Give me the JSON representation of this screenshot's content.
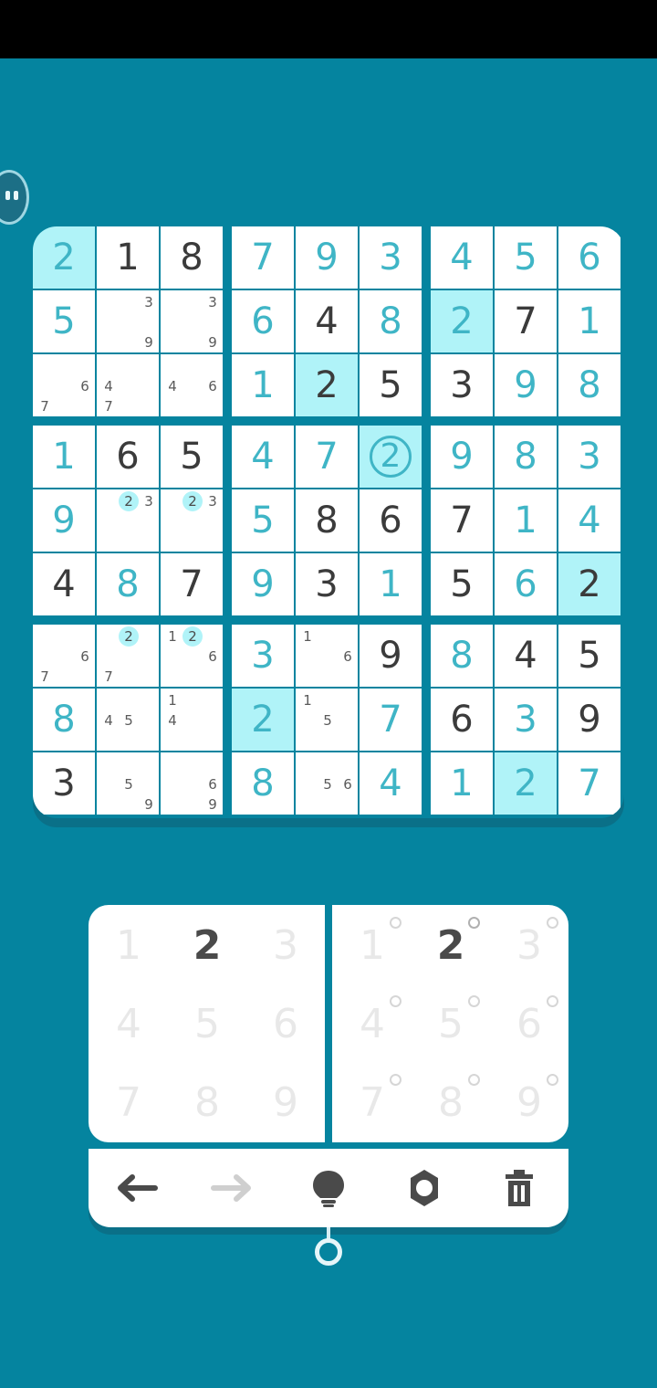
{
  "board": {
    "rows": [
      [
        {
          "v": "2",
          "t": "user",
          "hl": true
        },
        {
          "v": "1",
          "t": "given"
        },
        {
          "v": "8",
          "t": "given"
        },
        {
          "v": "7",
          "t": "user"
        },
        {
          "v": "9",
          "t": "user"
        },
        {
          "v": "3",
          "t": "user"
        },
        {
          "v": "4",
          "t": "user"
        },
        {
          "v": "5",
          "t": "user"
        },
        {
          "v": "6",
          "t": "user"
        }
      ],
      [
        {
          "v": "5",
          "t": "user"
        },
        {
          "notes": [
            "3",
            "9"
          ]
        },
        {
          "notes": [
            "3",
            "9"
          ]
        },
        {
          "v": "6",
          "t": "user"
        },
        {
          "v": "4",
          "t": "given"
        },
        {
          "v": "8",
          "t": "user"
        },
        {
          "v": "2",
          "t": "user",
          "hl": true
        },
        {
          "v": "7",
          "t": "given"
        },
        {
          "v": "1",
          "t": "user"
        }
      ],
      [
        {
          "notes": [
            "6",
            "7"
          ]
        },
        {
          "notes": [
            "4",
            "7"
          ]
        },
        {
          "notes": [
            "4",
            "6"
          ]
        },
        {
          "v": "1",
          "t": "user"
        },
        {
          "v": "2",
          "t": "given",
          "hl": true
        },
        {
          "v": "5",
          "t": "given"
        },
        {
          "v": "3",
          "t": "given"
        },
        {
          "v": "9",
          "t": "user"
        },
        {
          "v": "8",
          "t": "user"
        }
      ],
      [
        {
          "v": "1",
          "t": "user"
        },
        {
          "v": "6",
          "t": "given"
        },
        {
          "v": "5",
          "t": "given"
        },
        {
          "v": "4",
          "t": "user"
        },
        {
          "v": "7",
          "t": "user"
        },
        {
          "v": "2",
          "t": "user",
          "hl": true,
          "ring": true
        },
        {
          "v": "9",
          "t": "user"
        },
        {
          "v": "8",
          "t": "user"
        },
        {
          "v": "3",
          "t": "user"
        }
      ],
      [
        {
          "v": "9",
          "t": "user"
        },
        {
          "notes": [
            "2",
            "3"
          ],
          "noteHl": [
            "2"
          ]
        },
        {
          "notes": [
            "2",
            "3"
          ],
          "noteHl": [
            "2"
          ]
        },
        {
          "v": "5",
          "t": "user"
        },
        {
          "v": "8",
          "t": "given"
        },
        {
          "v": "6",
          "t": "given"
        },
        {
          "v": "7",
          "t": "given"
        },
        {
          "v": "1",
          "t": "user"
        },
        {
          "v": "4",
          "t": "user"
        }
      ],
      [
        {
          "v": "4",
          "t": "given"
        },
        {
          "v": "8",
          "t": "user"
        },
        {
          "v": "7",
          "t": "given"
        },
        {
          "v": "9",
          "t": "user"
        },
        {
          "v": "3",
          "t": "given"
        },
        {
          "v": "1",
          "t": "user"
        },
        {
          "v": "5",
          "t": "given"
        },
        {
          "v": "6",
          "t": "user"
        },
        {
          "v": "2",
          "t": "given",
          "hl": true
        }
      ],
      [
        {
          "notes": [
            "6",
            "7"
          ]
        },
        {
          "notes": [
            "2",
            "7"
          ],
          "noteHl": [
            "2"
          ]
        },
        {
          "notes": [
            "1",
            "2",
            "6"
          ],
          "noteHl": [
            "2"
          ]
        },
        {
          "v": "3",
          "t": "user"
        },
        {
          "notes": [
            "1",
            "6"
          ]
        },
        {
          "v": "9",
          "t": "given"
        },
        {
          "v": "8",
          "t": "user"
        },
        {
          "v": "4",
          "t": "given"
        },
        {
          "v": "5",
          "t": "given"
        }
      ],
      [
        {
          "v": "8",
          "t": "user"
        },
        {
          "notes": [
            "4",
            "5"
          ]
        },
        {
          "notes": [
            "1",
            "4"
          ]
        },
        {
          "v": "2",
          "t": "user",
          "hl": true
        },
        {
          "notes": [
            "1",
            "5"
          ]
        },
        {
          "v": "7",
          "t": "user"
        },
        {
          "v": "6",
          "t": "given"
        },
        {
          "v": "3",
          "t": "user"
        },
        {
          "v": "9",
          "t": "given"
        }
      ],
      [
        {
          "v": "3",
          "t": "given"
        },
        {
          "notes": [
            "5",
            "9"
          ]
        },
        {
          "notes": [
            "6",
            "9"
          ]
        },
        {
          "v": "8",
          "t": "user"
        },
        {
          "notes": [
            "5",
            "6"
          ]
        },
        {
          "v": "4",
          "t": "user"
        },
        {
          "v": "1",
          "t": "user"
        },
        {
          "v": "2",
          "t": "user",
          "hl": true
        },
        {
          "v": "7",
          "t": "user"
        }
      ]
    ]
  },
  "numpad": {
    "value_keys": [
      "1",
      "2",
      "3",
      "4",
      "5",
      "6",
      "7",
      "8",
      "9"
    ],
    "note_keys": [
      "1",
      "2",
      "3",
      "4",
      "5",
      "6",
      "7",
      "8",
      "9"
    ],
    "active_key": "2"
  },
  "toolbar": {
    "tools": [
      {
        "name": "undo-button",
        "icon": "arrow-left-icon",
        "enabled": true
      },
      {
        "name": "redo-button",
        "icon": "arrow-right-icon",
        "enabled": false
      },
      {
        "name": "hint-button",
        "icon": "lightbulb-icon",
        "enabled": true
      },
      {
        "name": "settings-button",
        "icon": "gear-icon",
        "enabled": true
      },
      {
        "name": "erase-button",
        "icon": "trash-icon",
        "enabled": true
      }
    ]
  },
  "colors": {
    "background": "#05849f",
    "user_digit": "#3fb5c6",
    "given_digit": "#3b3b3b",
    "highlight": "#b0f3f8"
  }
}
